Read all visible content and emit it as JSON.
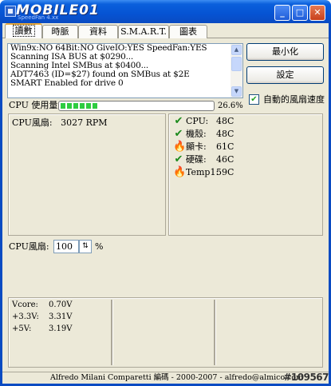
{
  "window": {
    "title": "MOBILE01",
    "subtitle": "SpeedFan 4.xx",
    "minimize_glyph": "_",
    "maximize_glyph": "□",
    "close_glyph": "✕"
  },
  "tabs": [
    {
      "label": "讀數",
      "active": true
    },
    {
      "label": "時脈",
      "active": false
    },
    {
      "label": "資料",
      "active": false
    },
    {
      "label": "S.M.A.R.T.",
      "active": false
    },
    {
      "label": "圖表",
      "active": false
    }
  ],
  "log": {
    "lines": [
      "Win9x:NO  64Bit:NO  GiveIO:YES  SpeedFan:YES",
      "Scanning ISA BUS at $0290...",
      "Scanning Intel SMBus at $0400...",
      "ADT7463 (ID=$27) found on SMBus at $2E",
      "SMART Enabled for drive 0"
    ]
  },
  "buttons": {
    "minimize": "最小化",
    "settings": "設定"
  },
  "auto_fan": {
    "label": "自動的風扇速度",
    "checked": true,
    "check_glyph": "✔"
  },
  "cpu_usage": {
    "label": "CPU 使用量",
    "value": "26.6%",
    "percent": 26.6
  },
  "fans": {
    "cpu_fan_label": "CPU風扇:",
    "cpu_fan_value": "3027 RPM"
  },
  "temps": [
    {
      "name": "CPU:",
      "value": "48C",
      "status": "ok",
      "icon": "check-icon",
      "glyph": "✔"
    },
    {
      "name": "機殼:",
      "value": "48C",
      "status": "ok",
      "icon": "check-icon",
      "glyph": "✔"
    },
    {
      "name": "顯卡:",
      "value": "61C",
      "status": "hot",
      "icon": "flame-icon",
      "glyph": "🔥"
    },
    {
      "name": "硬碟:",
      "value": "46C",
      "status": "ok",
      "icon": "check-icon",
      "glyph": "✔"
    },
    {
      "name": "Temp1:",
      "value": "59C",
      "status": "hot",
      "icon": "flame-icon",
      "glyph": "🔥"
    }
  ],
  "fan_speed": {
    "label": "CPU風扇:",
    "value": "100",
    "unit": "%",
    "spin_glyph": "⇅"
  },
  "voltages": [
    {
      "name": "Vcore:",
      "value": "0.70V"
    },
    {
      "name": "+3.3V:",
      "value": "3.31V"
    },
    {
      "name": "+5V:",
      "value": "3.19V"
    }
  ],
  "status_bar": {
    "text": "Alfredo Milani Comparetti 編碼 - 2000-2007 - alfredo@almico.com",
    "watermark": "#109567"
  },
  "colors": {
    "titlebar": "#0653d3",
    "client_bg": "#ece9d8",
    "progress": "#2ecc40",
    "ok": "#1b8a1b",
    "hot": "#e8400c"
  }
}
